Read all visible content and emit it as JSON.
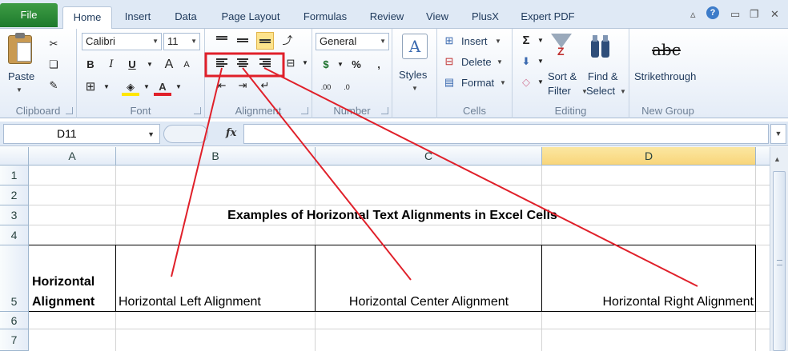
{
  "tabs": [
    "File",
    "Home",
    "Insert",
    "Data",
    "Page Layout",
    "Formulas",
    "Review",
    "View",
    "PlusX",
    "Expert PDF"
  ],
  "active_tab": "Home",
  "ribbon": {
    "clipboard": {
      "paste": "Paste",
      "label": "Clipboard"
    },
    "font": {
      "name": "Calibri",
      "size": "11",
      "bold": "B",
      "italic": "I",
      "underline": "U",
      "label": "Font"
    },
    "alignment": {
      "label": "Alignment"
    },
    "number": {
      "format": "General",
      "percent": "%",
      "comma": ",",
      "currency": "$",
      "inc_dec": ".00",
      "label": "Number"
    },
    "styles": {
      "label": "Styles"
    },
    "cells": {
      "insert": "Insert",
      "delete": "Delete",
      "format": "Format",
      "label": "Cells"
    },
    "editing": {
      "sum": "Σ",
      "sort_line1": "Sort &",
      "sort_line2": "Filter",
      "find_line1": "Find &",
      "find_line2": "Select",
      "label": "Editing"
    },
    "new_group": {
      "strike_icon_text": "abc",
      "strikethrough": "Strikethrough",
      "label": "New Group"
    }
  },
  "formula_bar": {
    "name_box": "D11",
    "fx": "fx",
    "formula": ""
  },
  "columns": [
    "A",
    "B",
    "C",
    "D"
  ],
  "rows": [
    "1",
    "2",
    "3",
    "4",
    "5",
    "6",
    "7"
  ],
  "cells": {
    "title": "Examples of Horizontal Text Alignments in Excel Cells",
    "a5_line1": "Horizontal",
    "a5_line2": "Alignment",
    "b5": "Horizontal Left Alignment",
    "c5": "Horizontal Center Alignment",
    "d5": "Horizontal Right Alignment"
  },
  "colors": {
    "annotation": "#e0202a",
    "selected_column": "#f8d57a",
    "file_tab": "#2a8a36"
  }
}
